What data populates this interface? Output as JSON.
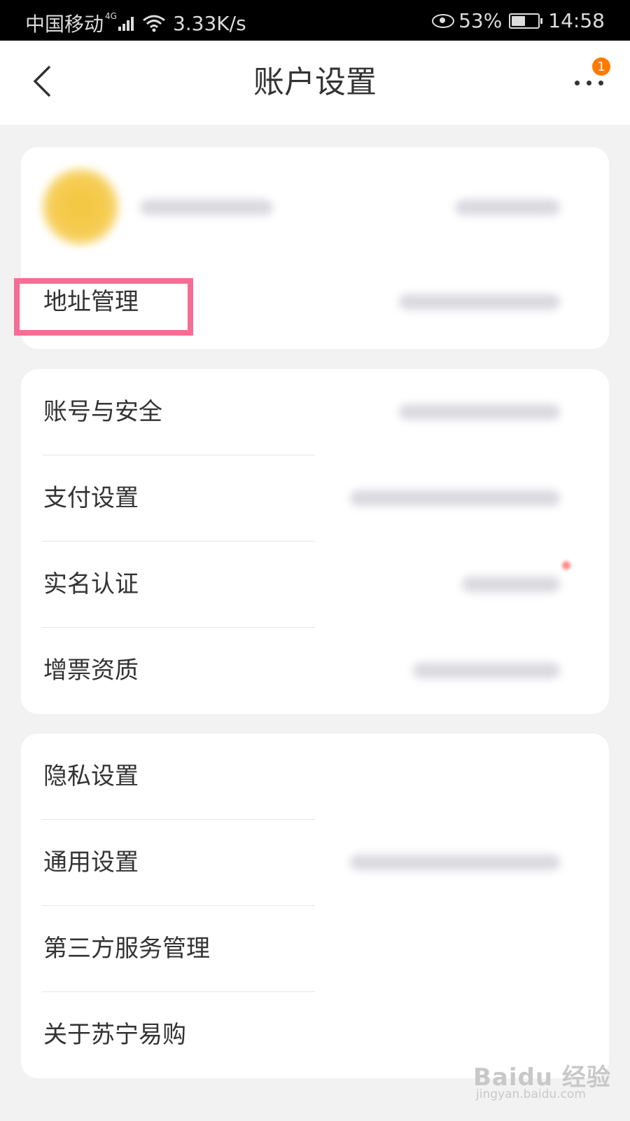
{
  "status_bar": {
    "carrier": "中国移动",
    "network": "4G",
    "speed": "3.33K/s",
    "battery_percent": "53%",
    "battery_level": 0.53,
    "time": "14:58"
  },
  "header": {
    "title": "账户设置",
    "notification_count": "1"
  },
  "sections": [
    {
      "items": [
        {
          "label": "地址管理"
        }
      ]
    },
    {
      "items": [
        {
          "label": "账号与安全"
        },
        {
          "label": "支付设置"
        },
        {
          "label": "实名认证"
        },
        {
          "label": "增票资质"
        }
      ]
    },
    {
      "items": [
        {
          "label": "隐私设置"
        },
        {
          "label": "通用设置"
        },
        {
          "label": "第三方服务管理"
        },
        {
          "label": "关于苏宁易购"
        }
      ]
    }
  ],
  "watermark": {
    "logo": "Baidu 经验",
    "url": "jingyan.baidu.com"
  },
  "colors": {
    "highlight": "#f46e94",
    "badge": "#ff7a00",
    "avatar": "#f3c63f"
  }
}
